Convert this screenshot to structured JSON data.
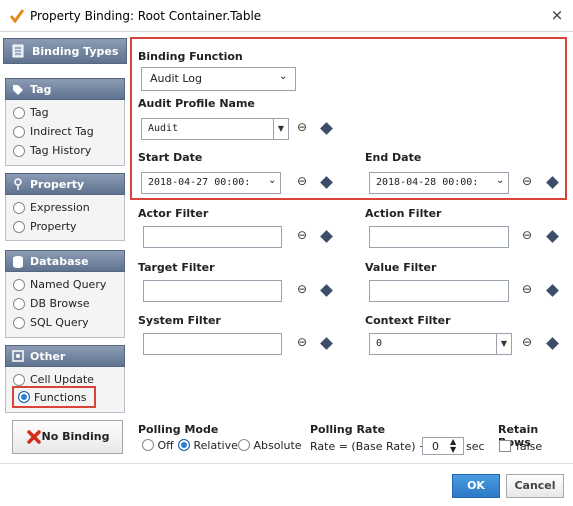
{
  "window": {
    "title": "Property Binding: Root Container.Table",
    "close": "×"
  },
  "sidebar": {
    "binding_types": "Binding Types",
    "sections": [
      {
        "title": "Tag",
        "items": [
          "Tag",
          "Indirect Tag",
          "Tag History"
        ]
      },
      {
        "title": "Property",
        "items": [
          "Expression",
          "Property"
        ]
      },
      {
        "title": "Database",
        "items": [
          "Named Query",
          "DB Browse",
          "SQL Query"
        ]
      },
      {
        "title": "Other",
        "items": [
          "Cell Update",
          "Functions"
        ]
      }
    ],
    "selected": "Functions",
    "no_binding": "No Binding"
  },
  "main": {
    "binding_function_label": "Binding Function",
    "binding_function_value": "Audit Log",
    "audit_profile_label": "Audit Profile Name",
    "audit_profile_value": "Audit",
    "start_date_label": "Start Date",
    "start_date_value": "2018-04-27 00:00:",
    "end_date_label": "End Date",
    "end_date_value": "2018-04-28 00:00:",
    "actor_filter_label": "Actor Filter",
    "action_filter_label": "Action Filter",
    "target_filter_label": "Target Filter",
    "value_filter_label": "Value Filter",
    "system_filter_label": "System Filter",
    "context_filter_label": "Context Filter",
    "context_filter_value": "0"
  },
  "polling": {
    "mode_label": "Polling Mode",
    "off": "Off",
    "relative": "Relative",
    "absolute": "Absolute",
    "rate_label": "Polling Rate",
    "rate_text": "Rate = (Base Rate) +/-",
    "rate_value": "0",
    "sec": "sec",
    "retain_label": "Retain Rows",
    "retain_value": "false"
  },
  "footer": {
    "ok": "OK",
    "cancel": "Cancel"
  },
  "colors": {
    "accent": "#2a7fd4",
    "highlight": "#d9443a",
    "header": "#6f819c"
  }
}
